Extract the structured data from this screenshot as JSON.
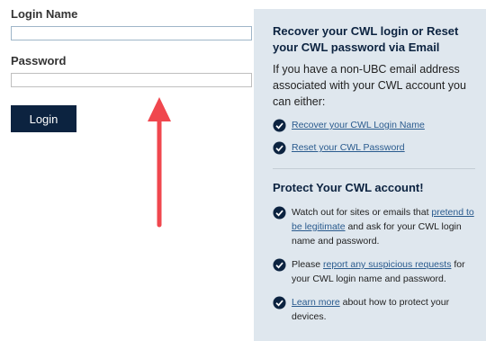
{
  "login": {
    "name_label": "Login Name",
    "password_label": "Password",
    "name_value": "",
    "password_value": "",
    "button_label": "Login"
  },
  "recover": {
    "title": "Recover your CWL login or Reset your CWL password via Email",
    "intro": "If you have a non-UBC email address associated with your CWL account you can either:",
    "links": [
      "Recover your CWL Login Name",
      "Reset your CWL Password"
    ]
  },
  "protect": {
    "title": "Protect Your CWL account!",
    "item1": {
      "pre": "Watch out for sites or emails that ",
      "link": "pretend to be legitimate",
      "post": " and ask for your CWL login name and password."
    },
    "item2": {
      "pre": "Please ",
      "link": "report any suspicious requests",
      "post": " for your CWL login name and password."
    },
    "item3": {
      "pre": "",
      "link": "Learn more",
      "post": " about how to protect your devices."
    }
  },
  "colors": {
    "button": "#0c2340",
    "panel": "#dfe7ee",
    "arrow": "#f0474e",
    "link": "#2a5b8e",
    "check_icon": "#0c2340"
  },
  "icons": {
    "check": "check-circle-icon",
    "annotation": "up-arrow-icon"
  }
}
